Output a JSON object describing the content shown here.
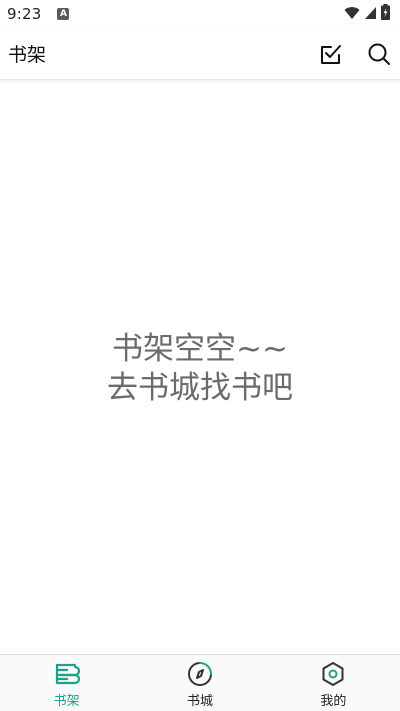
{
  "status_bar": {
    "time": "9:23",
    "notification_icon": "A"
  },
  "app_bar": {
    "title": "书架"
  },
  "empty_state": {
    "line1": "书架空空~~",
    "line2": "去书城找书吧"
  },
  "bottom_nav": {
    "items": [
      {
        "label": "书架",
        "icon": "bookshelf-icon",
        "active": true
      },
      {
        "label": "书城",
        "icon": "compass-icon",
        "active": false
      },
      {
        "label": "我的",
        "icon": "hexagon-profile-icon",
        "active": false
      }
    ]
  },
  "colors": {
    "accent": "#1fa187",
    "empty_text": "#6b6b6b"
  }
}
